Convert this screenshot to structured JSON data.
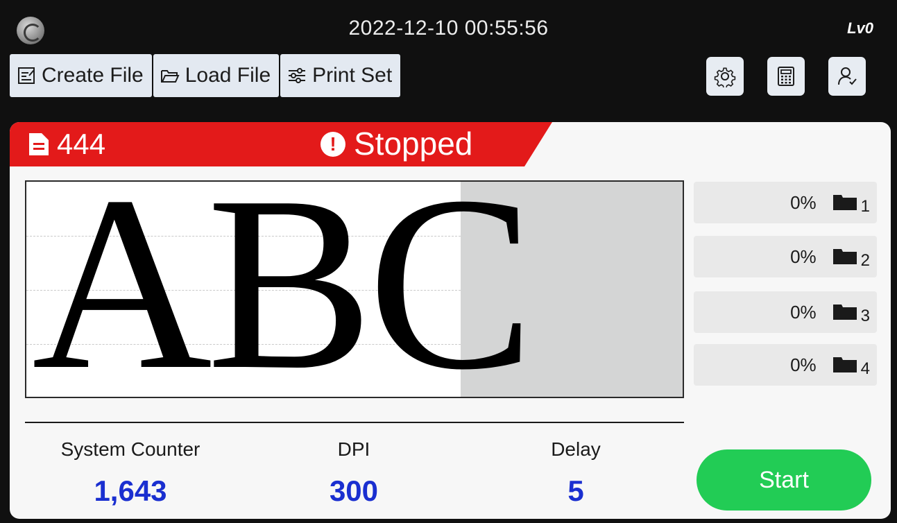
{
  "header": {
    "datetime": "2022-12-10 00:55:56",
    "level": "Lv0"
  },
  "toolbar": {
    "create_file": "Create File",
    "load_file": "Load File",
    "print_set": "Print Set"
  },
  "status": {
    "file_name": "444",
    "state": "Stopped"
  },
  "preview": {
    "text": "ABC"
  },
  "ink": [
    {
      "percent": "0%",
      "number": "1"
    },
    {
      "percent": "0%",
      "number": "2"
    },
    {
      "percent": "0%",
      "number": "3"
    },
    {
      "percent": "0%",
      "number": "4"
    }
  ],
  "stats": {
    "counter_label": "System Counter",
    "counter_value": "1,643",
    "dpi_label": "DPI",
    "dpi_value": "300",
    "delay_label": "Delay",
    "delay_value": "5"
  },
  "start_label": "Start",
  "icons": {
    "logo": "gauge-logo-icon",
    "create": "edit-file-icon",
    "load": "folder-open-icon",
    "print_set": "sliders-icon",
    "settings": "gear-icon",
    "calculator": "calculator-icon",
    "user": "user-icon",
    "file": "document-icon",
    "alert": "exclamation-icon",
    "cartridge": "ink-cartridge-icon"
  },
  "colors": {
    "status_red": "#e31a1a",
    "start_green": "#22cc55",
    "value_blue": "#1a2fd0"
  }
}
